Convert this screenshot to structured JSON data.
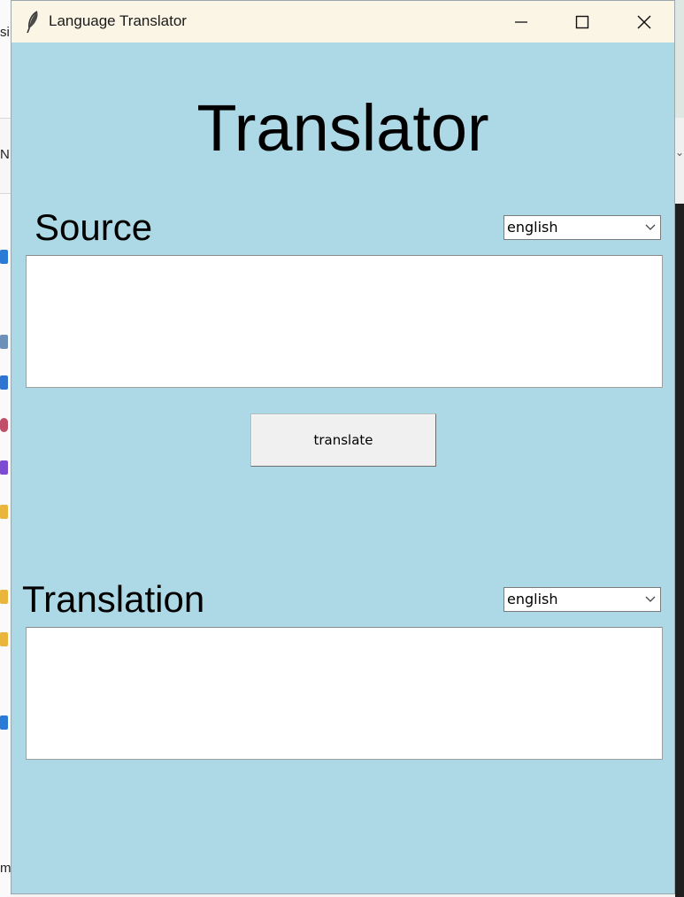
{
  "window": {
    "title": "Language Translator"
  },
  "main": {
    "heading": "Translator",
    "source": {
      "label": "Source",
      "language": "english",
      "text": ""
    },
    "translate_button": "translate",
    "target": {
      "label": "Translation",
      "language": "english",
      "text": ""
    }
  },
  "background": {
    "left_glyph_top": "si",
    "left_glyph_mid": "N",
    "left_glyph_bottom": "m"
  },
  "colors": {
    "window_bg": "#add8e6",
    "titlebar_bg": "#fbf5e6",
    "button_bg": "#f0f0f0"
  }
}
